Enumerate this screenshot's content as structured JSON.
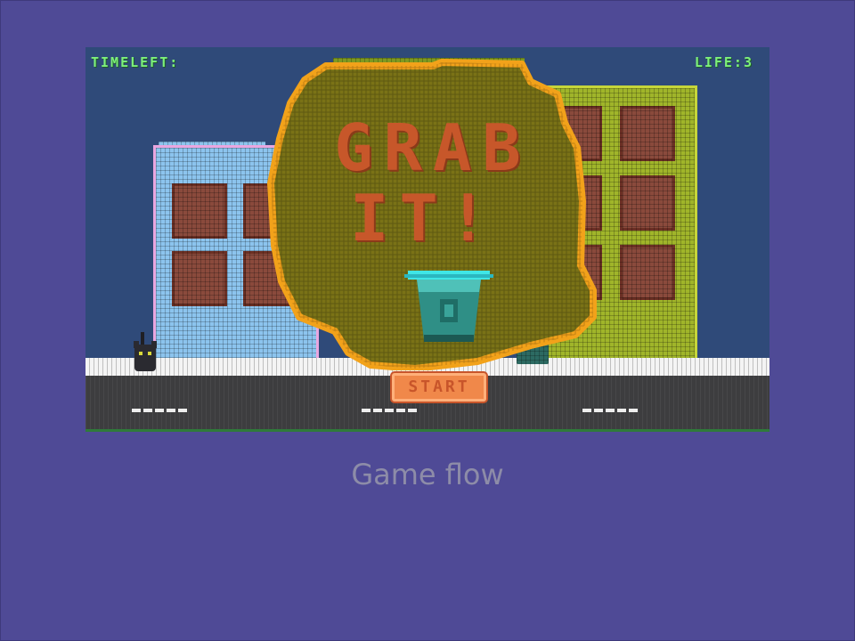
{
  "hud": {
    "time_label": "TIMELEFT:",
    "life_label": "LIFE:3"
  },
  "splash": {
    "title_line1": "GRAB",
    "title_line2": "IT!",
    "start_label": "START"
  },
  "caption": "Game flow",
  "icons": {
    "bucket": "trash-bin-icon",
    "cat": "black-cat-sprite",
    "small_bin": "trash-bin-icon"
  },
  "colors": {
    "background": "#4f4a96",
    "hud_text": "#7ef07a",
    "blob_fill": "#7a7216",
    "blob_outline": "#f2a21a",
    "title_text": "#c7572a",
    "bucket_rim": "#3fe6e6",
    "bucket_body": "#2f8f86"
  }
}
